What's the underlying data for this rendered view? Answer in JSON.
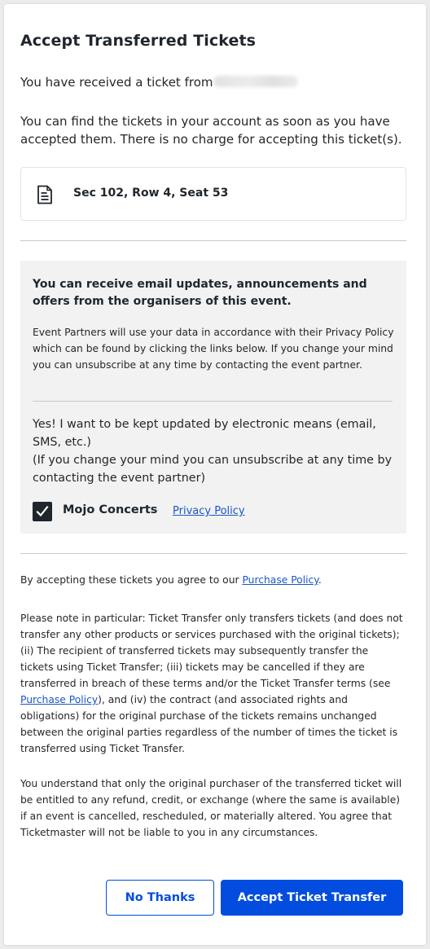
{
  "modal": {
    "title": "Accept Transferred Tickets",
    "received_text": "You have received a ticket from",
    "find_text": "You can find the tickets in your account as soon as you have accepted them. There is no charge for accepting this ticket(s)."
  },
  "ticket": {
    "icon": "document-icon",
    "seat": "Sec 102, Row 4, Seat 53"
  },
  "opt_in": {
    "heading": "You can receive email updates, announcements and offers from the organisers of this event.",
    "body": "Event Partners will use your data in accordance with their Privacy Policy which can be found by clicking the links below. If you change your mind you can unsubscribe at any time by contacting the event partner.",
    "consent_line1": "Yes! I want to be kept updated by electronic means (email, SMS, etc.)",
    "consent_line2": "(If you change your mind you can unsubscribe at any time by contacting the event partner)",
    "organiser": "Mojo Concerts",
    "privacy_link": "Privacy Policy",
    "checked": true
  },
  "terms": {
    "agree_prefix": "By accepting these tickets you agree to our ",
    "purchase_policy": "Purchase Policy",
    "agree_suffix": ".",
    "note_part1": "Please note in particular: Ticket Transfer only transfers tickets (and does not transfer any other products or services purchased with the original tickets); (ii) The recipient of transferred tickets may subsequently transfer the tickets using Ticket Transfer; (iii) tickets may be cancelled if they are transferred in breach of these terms and/or the Ticket Transfer terms (see ",
    "note_part2": "), and (iv) the contract (and associated rights and obligations) for the original purchase of the tickets remains unchanged between the original parties regardless of the number of times the ticket is transferred using Ticket Transfer.",
    "understand": "You understand that only the original purchaser of the transferred ticket will be entitled to any refund, credit, or exchange (where the same is available) if an event is cancelled, rescheduled, or materially altered. You agree that Ticketmaster will not be liable to you in any circumstances."
  },
  "buttons": {
    "no_thanks": "No Thanks",
    "accept": "Accept Ticket Transfer"
  },
  "colors": {
    "primary": "#024ddf",
    "link": "#1a56c6",
    "panel_bg": "#f2f2f2",
    "text": "#1f262d"
  }
}
